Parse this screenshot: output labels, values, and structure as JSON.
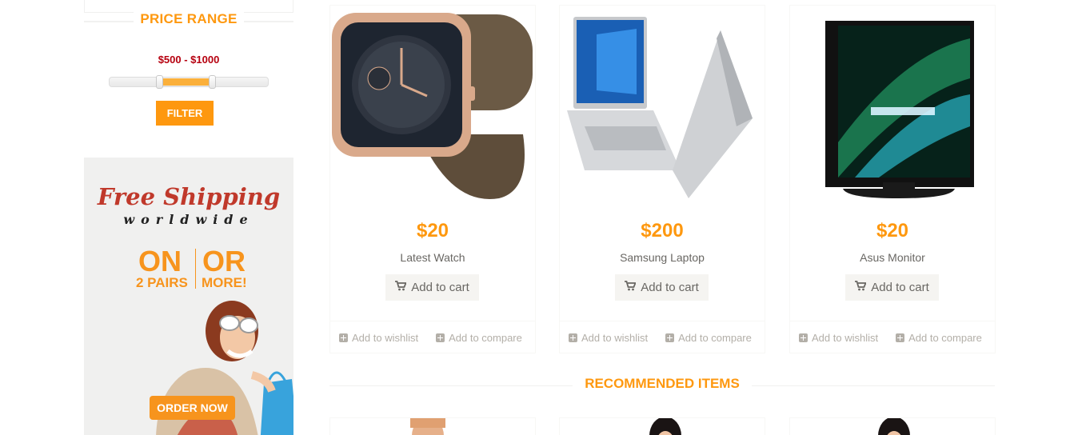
{
  "sidebar": {
    "price_range_title": "PRICE RANGE",
    "price_range_value": "$500 - $1000",
    "filter_label": "FILTER",
    "promo": {
      "title": "Free Shipping",
      "subtitle": "worldwide",
      "left_big": "ON",
      "right_big": "OR",
      "left_small": "2 PAIRS",
      "right_small": "MORE!",
      "button_label": "ORDER NOW"
    }
  },
  "products": [
    {
      "price": "$20",
      "name": "Latest Watch",
      "cart_label": "Add to cart",
      "wishlist_label": "Add to wishlist",
      "compare_label": "Add to compare"
    },
    {
      "price": "$200",
      "name": "Samsung Laptop",
      "cart_label": "Add to cart",
      "wishlist_label": "Add to wishlist",
      "compare_label": "Add to compare"
    },
    {
      "price": "$20",
      "name": "Asus Monitor",
      "cart_label": "Add to cart",
      "wishlist_label": "Add to wishlist",
      "compare_label": "Add to compare"
    }
  ],
  "recommended_title": "RECOMMENDED ITEMS",
  "colors": {
    "accent": "#fe980f",
    "price_range_value": "#b6000f",
    "promo_title": "#c0392b"
  },
  "icons": {
    "cart": "shopping-cart-icon",
    "plus": "plus-square-icon"
  }
}
